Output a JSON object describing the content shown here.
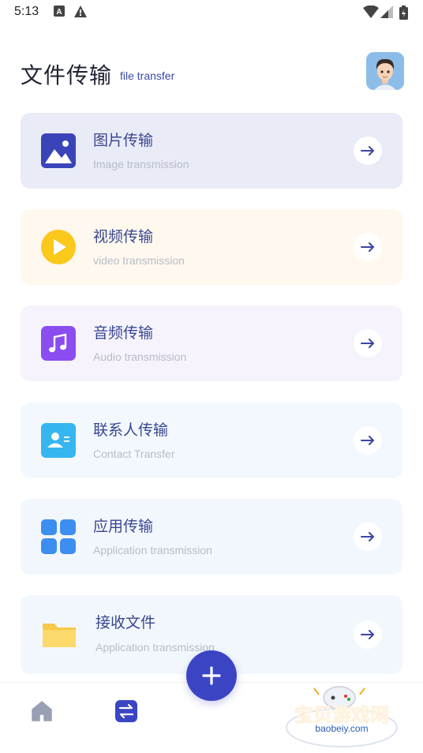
{
  "status_bar": {
    "time": "5:13"
  },
  "header": {
    "title": "文件传输",
    "subtitle": "file transfer"
  },
  "cards": [
    {
      "title": "图片传输",
      "subtitle": "Image transmission",
      "bg": "#e9ebf7",
      "icon": "image-icon"
    },
    {
      "title": "视频传输",
      "subtitle": "video transmission",
      "bg": "#fff8ef",
      "icon": "play-icon"
    },
    {
      "title": "音频传输",
      "subtitle": "Audio transmission",
      "bg": "#f6f3fd",
      "icon": "music-note-icon"
    },
    {
      "title": "联系人传输",
      "subtitle": "Contact Transfer",
      "bg": "#f2f8fe",
      "icon": "contact-card-icon"
    },
    {
      "title": "应用传输",
      "subtitle": "Application transmission",
      "bg": "#f2f7fe",
      "icon": "apps-grid-icon"
    },
    {
      "title": "接收文件",
      "subtitle": "Application transmission",
      "bg": "#f2f7fe",
      "icon": "folder-icon"
    }
  ],
  "bottom_nav": {
    "home_icon": "home-icon",
    "transfer_icon": "transfer-icon",
    "fab_icon": "plus-icon"
  },
  "watermark": {
    "text": "宝贝游戏网",
    "url": "baobeiy.com"
  },
  "colors": {
    "accent": "#3b45c4",
    "title_text": "#3a4790"
  }
}
